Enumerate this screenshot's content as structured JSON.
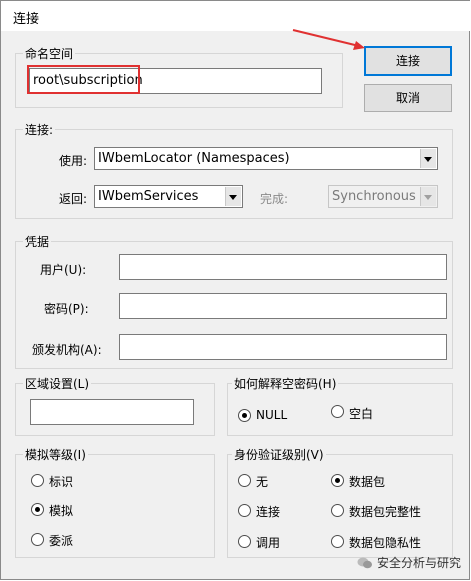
{
  "window": {
    "title": "连接"
  },
  "namespace": {
    "group_label": "命名空间",
    "value": "root\\subscription"
  },
  "buttons": {
    "connect": "连接",
    "cancel": "取消"
  },
  "connection": {
    "group_label": "连接:",
    "use_label": "使用:",
    "use_value": "IWbemLocator (Namespaces)",
    "return_label": "返回:",
    "return_value": "IWbemServices",
    "complete_label": "完成:",
    "complete_value": "Synchronous"
  },
  "credentials": {
    "group_label": "凭据",
    "user_label": "用户(U):",
    "password_label": "密码(P):",
    "authority_label": "颁发机构(A):",
    "user_value": "",
    "password_value": "",
    "authority_value": ""
  },
  "locale": {
    "group_label": "区域设置(L)",
    "value": ""
  },
  "null_password": {
    "group_label": "如何解释空密码(H)",
    "options": [
      {
        "label": "NULL",
        "checked": true
      },
      {
        "label": "空白",
        "checked": false
      }
    ]
  },
  "impersonation": {
    "group_label": "模拟等级(I)",
    "options": [
      {
        "label": "标识",
        "checked": false
      },
      {
        "label": "模拟",
        "checked": true
      },
      {
        "label": "委派",
        "checked": false
      }
    ]
  },
  "authentication": {
    "group_label": "身份验证级别(V)",
    "options": [
      {
        "label": "无",
        "checked": false
      },
      {
        "label": "数据包",
        "checked": true
      },
      {
        "label": "连接",
        "checked": false
      },
      {
        "label": "数据包完整性",
        "checked": false
      },
      {
        "label": "调用",
        "checked": false
      },
      {
        "label": "数据包隐私性",
        "checked": false
      }
    ]
  },
  "watermark": {
    "text": "安全分析与研究"
  },
  "colors": {
    "highlight": "#e03131",
    "accent": "#0078d7"
  }
}
